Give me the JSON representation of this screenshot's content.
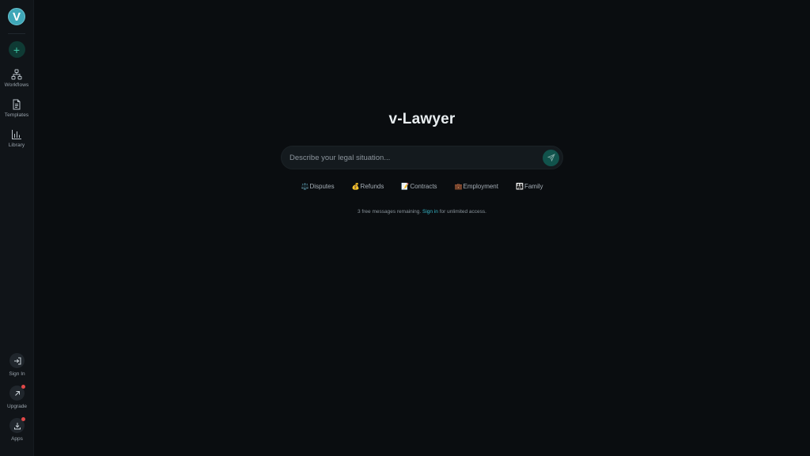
{
  "sidebar": {
    "logo_letter": "V",
    "new_button": "+",
    "items": [
      {
        "label": "Workflows",
        "icon": "workflow-icon"
      },
      {
        "label": "Templates",
        "icon": "document-icon"
      },
      {
        "label": "Library",
        "icon": "bar-chart-icon"
      }
    ],
    "bottom": [
      {
        "label": "Sign In",
        "icon": "sign-in-icon"
      },
      {
        "label": "Upgrade",
        "icon": "arrow-up-right-icon"
      },
      {
        "label": "Apps",
        "icon": "download-icon"
      }
    ]
  },
  "main": {
    "title": "v-Lawyer",
    "input_placeholder": "Describe your legal situation...",
    "chips": [
      {
        "emoji": "⚖️",
        "label": "Disputes"
      },
      {
        "emoji": "💰",
        "label": "Refunds"
      },
      {
        "emoji": "📝",
        "label": "Contracts"
      },
      {
        "emoji": "💼",
        "label": "Employment"
      },
      {
        "emoji": "👨‍👩‍👧",
        "label": "Family"
      }
    ],
    "notice_pre": "3 free messages remaining. ",
    "notice_link": "Sign in",
    "notice_post": " for unlimited access."
  },
  "colors": {
    "background": "#0a0d10",
    "sidebar": "#101418",
    "accent": "#36b7c9",
    "send_button": "#11534c",
    "badge": "#e04848"
  }
}
